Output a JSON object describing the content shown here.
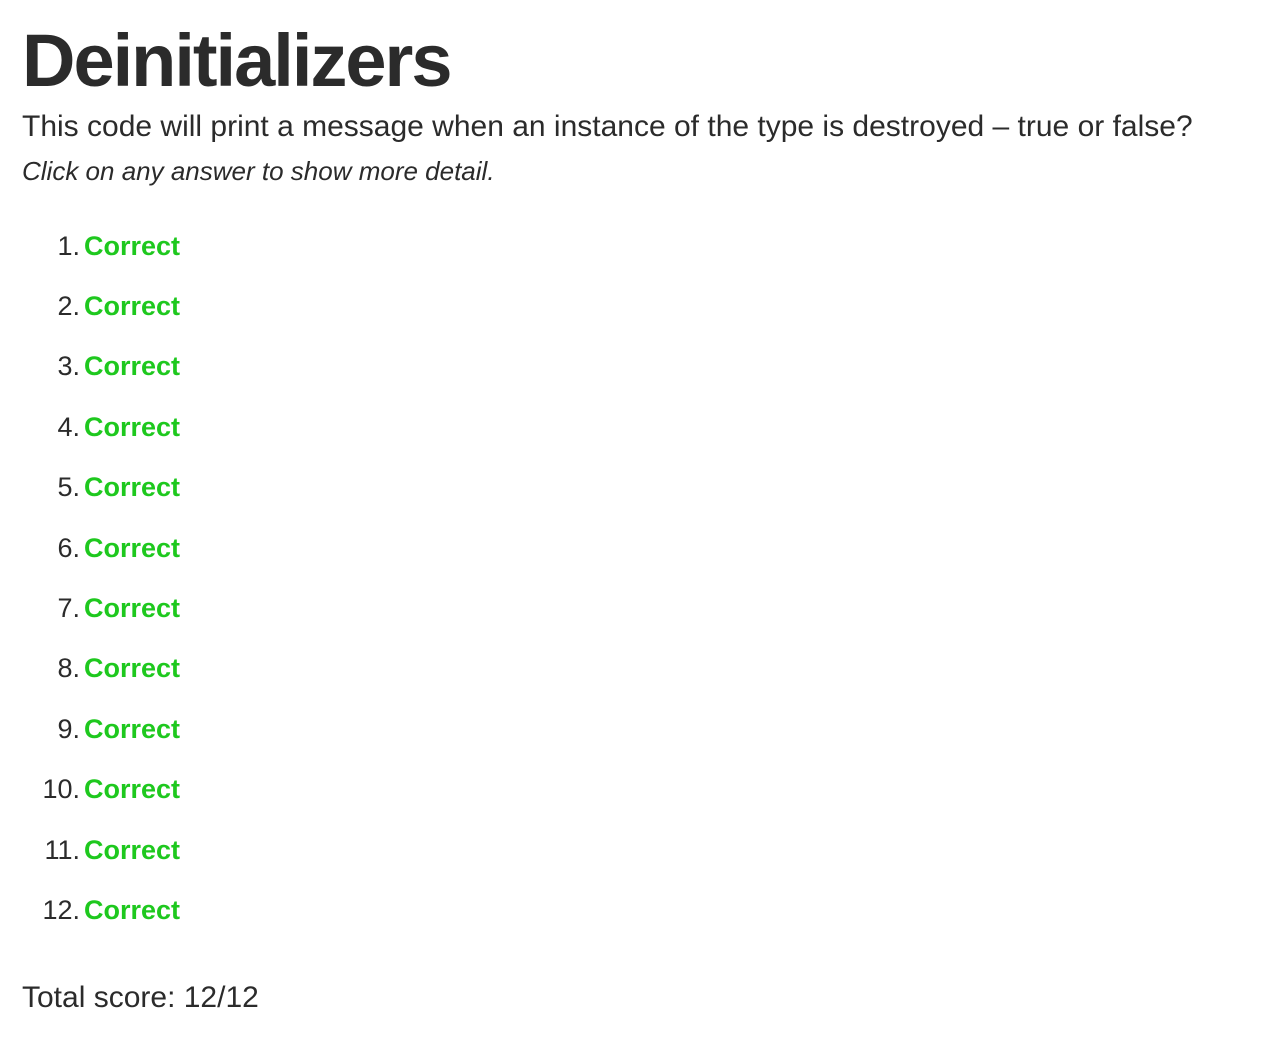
{
  "page": {
    "title": "Deinitializers",
    "question": "This code will print a message when an instance of the type is destroyed – true or false?",
    "hint": "Click on any answer to show more detail."
  },
  "answers": [
    {
      "number": "1.",
      "label": "Correct"
    },
    {
      "number": "2.",
      "label": "Correct"
    },
    {
      "number": "3.",
      "label": "Correct"
    },
    {
      "number": "4.",
      "label": "Correct"
    },
    {
      "number": "5.",
      "label": "Correct"
    },
    {
      "number": "6.",
      "label": "Correct"
    },
    {
      "number": "7.",
      "label": "Correct"
    },
    {
      "number": "8.",
      "label": "Correct"
    },
    {
      "number": "9.",
      "label": "Correct"
    },
    {
      "number": "10.",
      "label": "Correct"
    },
    {
      "number": "11.",
      "label": "Correct"
    },
    {
      "number": "12.",
      "label": "Correct"
    }
  ],
  "total": {
    "label": "Total score: 12/12"
  },
  "colors": {
    "correct": "#1ec81e",
    "text": "#2b2b2b"
  }
}
